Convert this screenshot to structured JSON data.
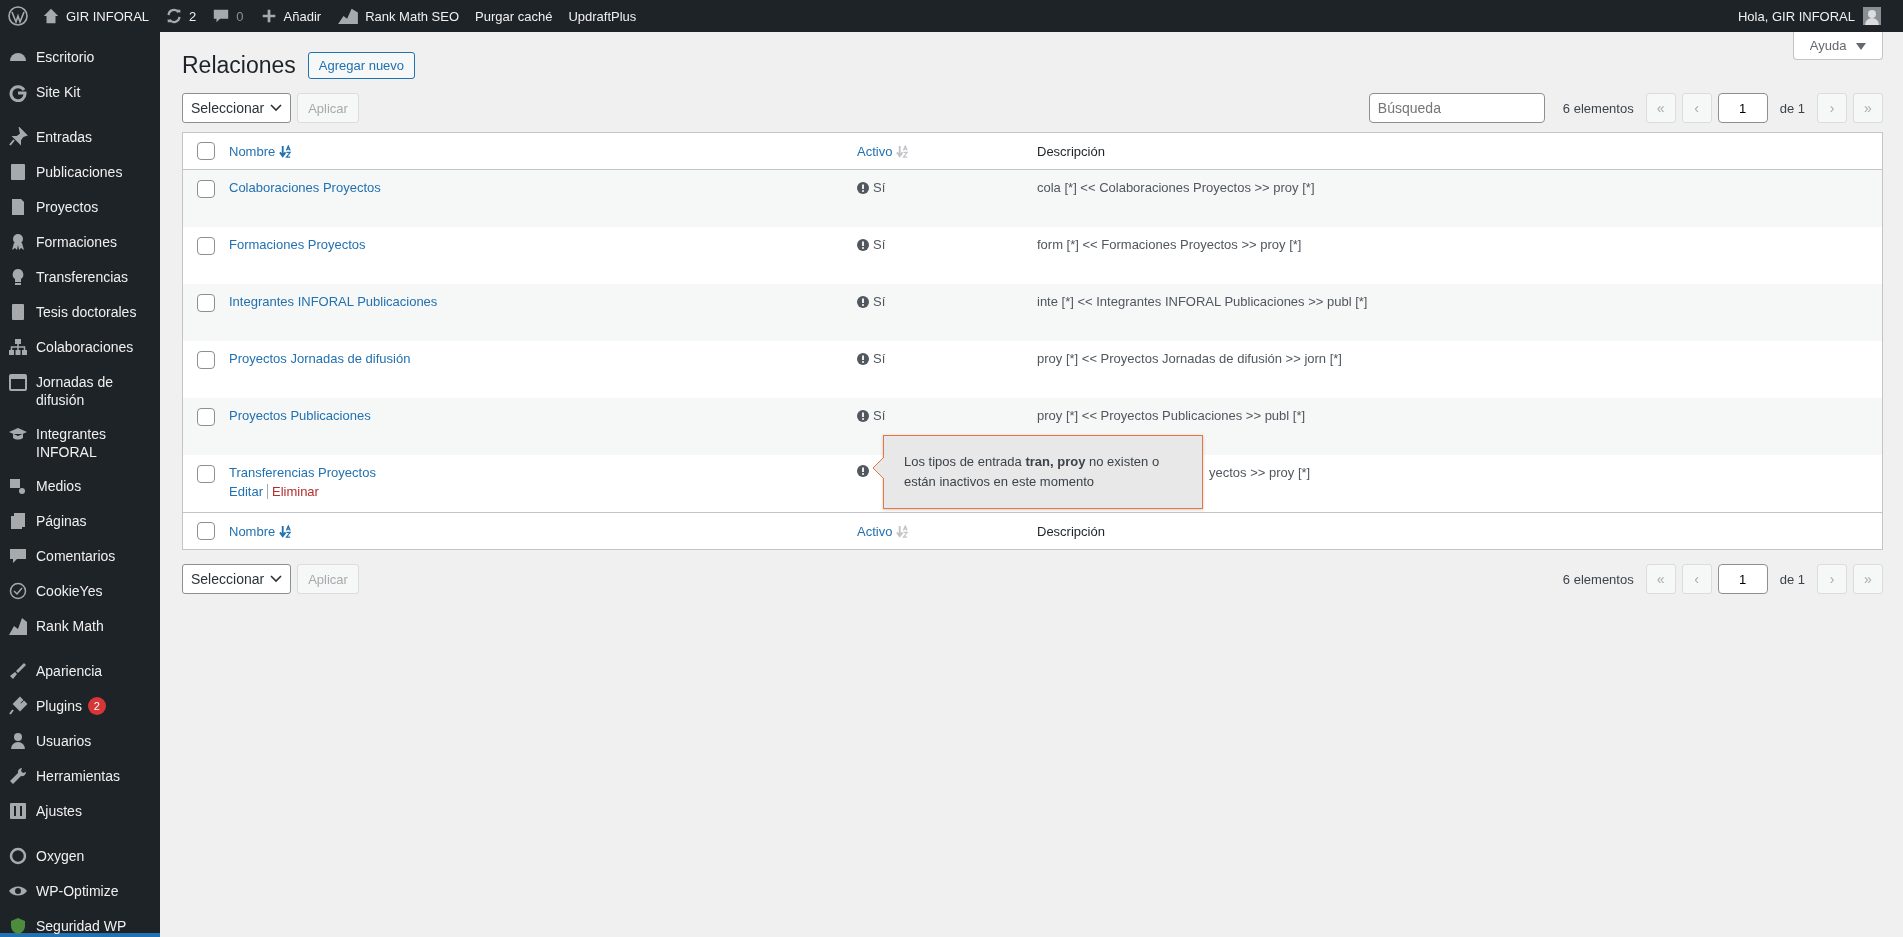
{
  "admin_bar": {
    "site_name": "GIR INFORAL",
    "updates": "2",
    "comments": "0",
    "items": [
      "Añadir",
      "Rank Math SEO",
      "Purgar caché",
      "UpdraftPlus"
    ],
    "greeting": "Hola, GIR INFORAL"
  },
  "sidebar": {
    "groups": [
      [
        {
          "label": "Escritorio"
        },
        {
          "label": "Site Kit"
        }
      ],
      [
        {
          "label": "Entradas"
        },
        {
          "label": "Publicaciones"
        },
        {
          "label": "Proyectos"
        },
        {
          "label": "Formaciones"
        },
        {
          "label": "Transferencias"
        },
        {
          "label": "Tesis doctorales"
        },
        {
          "label": "Colaboraciones"
        },
        {
          "label": "Jornadas de difusión"
        },
        {
          "label": "Integrantes INFORAL"
        },
        {
          "label": "Medios"
        },
        {
          "label": "Páginas"
        },
        {
          "label": "Comentarios"
        },
        {
          "label": "CookieYes"
        },
        {
          "label": "Rank Math"
        }
      ],
      [
        {
          "label": "Apariencia"
        },
        {
          "label": "Plugins",
          "badge": "2"
        },
        {
          "label": "Usuarios"
        },
        {
          "label": "Herramientas"
        },
        {
          "label": "Ajustes"
        }
      ],
      [
        {
          "label": "Oxygen"
        },
        {
          "label": "WP-Optimize"
        },
        {
          "label": "Seguridad WP"
        }
      ]
    ]
  },
  "help_button": "Ayuda",
  "page": {
    "title": "Relaciones",
    "add_button": "Agregar nuevo"
  },
  "bulk_actions": {
    "select": "Seleccionar",
    "apply": "Aplicar"
  },
  "search": {
    "placeholder": "Búsqueda"
  },
  "pagination": {
    "count": "6 elementos",
    "first": "«",
    "prev": "‹",
    "page": "1",
    "of": "de 1",
    "next": "›",
    "last": "»"
  },
  "table": {
    "select_all_checked": false,
    "columns": [
      {
        "label": "Nombre",
        "sorted": true
      },
      {
        "label": "Activo",
        "sorted": false
      },
      {
        "label": "Descripción"
      }
    ],
    "footer_select_all_checked": false,
    "footer_columns": [
      {
        "label": "Nombre",
        "sorted": true
      },
      {
        "label": "Activo",
        "sorted": false
      },
      {
        "label": "Descripción"
      }
    ],
    "rows": [
      {
        "name": "Colaboraciones Proyectos",
        "checked": false,
        "active": "Sí",
        "description": "cola [*] << Colaboraciones Proyectos >> proy [*]"
      },
      {
        "name": "Formaciones Proyectos",
        "checked": false,
        "active": "Sí",
        "description": "form [*] << Formaciones Proyectos >> proy [*]"
      },
      {
        "name": "Integrantes INFORAL Publicaciones",
        "checked": false,
        "active": "Sí",
        "description": "inte [*] << Integrantes INFORAL Publicaciones >> publ [*]"
      },
      {
        "name": "Proyectos Jornadas de difusión",
        "checked": false,
        "active": "Sí",
        "description": "proy [*] << Proyectos Jornadas de difusión >> jorn [*]"
      },
      {
        "name": "Proyectos Publicaciones",
        "checked": false,
        "active": "Sí",
        "description": "proy [*] << Proyectos Publicaciones >> publ [*]"
      },
      {
        "name": "Transferencias Proyectos",
        "checked": false,
        "description": "yectos >> proy [*]",
        "actions": [
          "Editar",
          "Eliminar"
        ],
        "tooltip": "Los tipos de entrada **tran, proy** no existen o están inactivos en este momento"
      }
    ]
  },
  "bottom_bulk_actions": {
    "select": "Seleccionar",
    "apply": "Aplicar"
  },
  "bottom_pagination": {
    "count": "6 elementos",
    "first": "«",
    "prev": "‹",
    "page": "1",
    "of": "de 1",
    "next": "›",
    "last": "»"
  }
}
